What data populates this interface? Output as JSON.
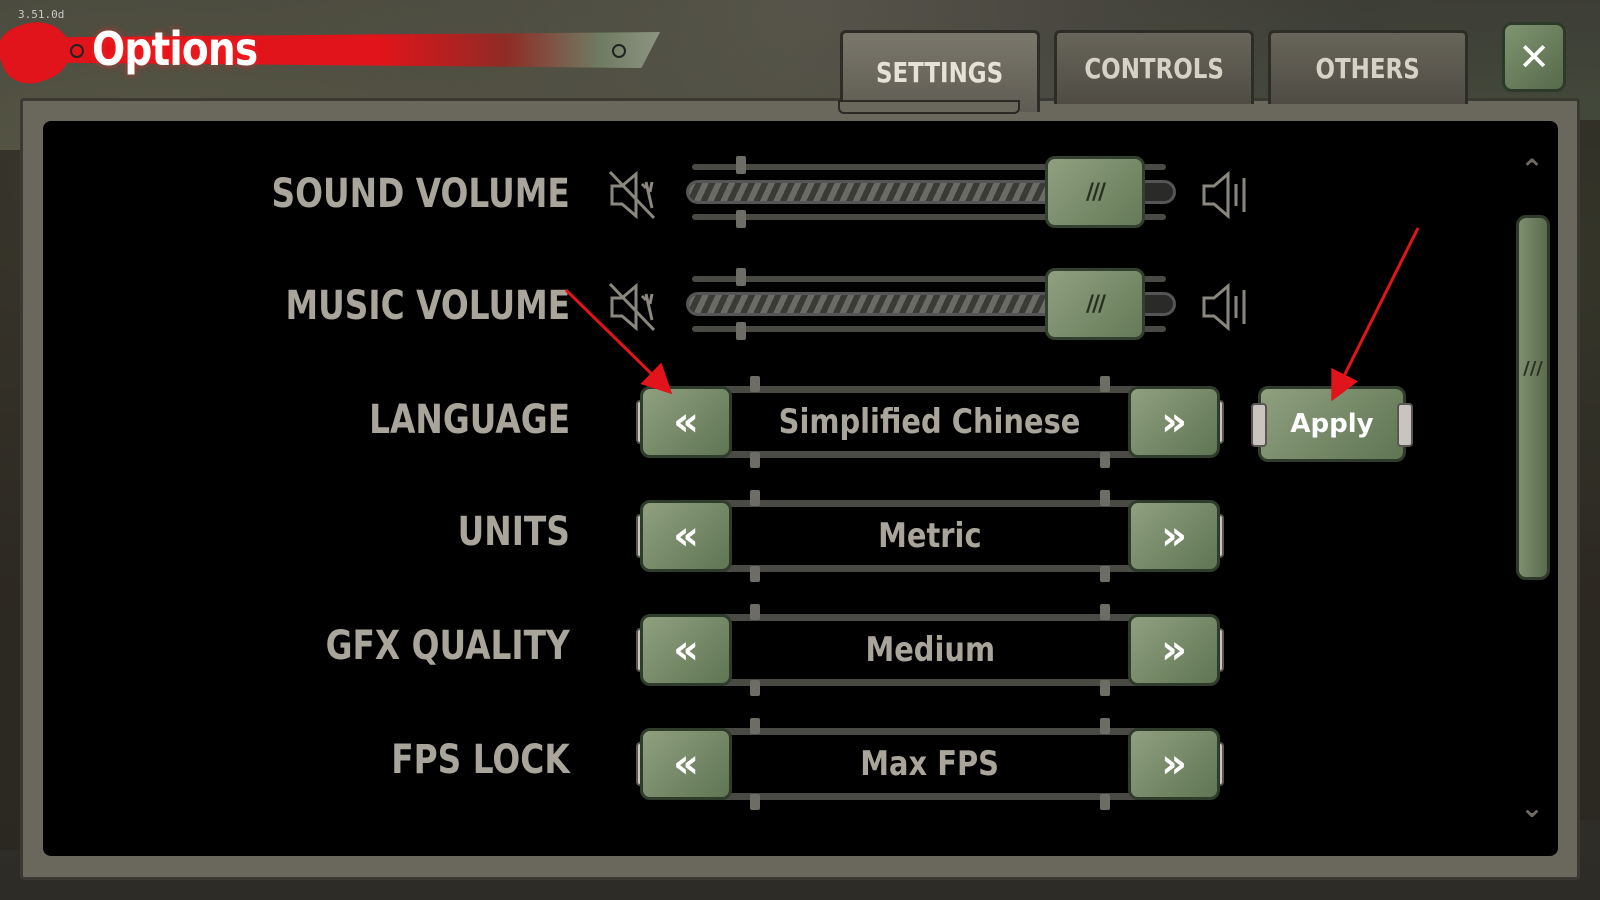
{
  "header": {
    "version": "3.51.0d",
    "title": "Options",
    "close_label": "✕"
  },
  "tabs": [
    {
      "label": "SETTINGS",
      "active": true
    },
    {
      "label": "CONTROLS",
      "active": false
    },
    {
      "label": "OTHERS",
      "active": false
    }
  ],
  "settings": {
    "sound_volume": {
      "label": "SOUND VOLUME",
      "value_fraction": 0.92
    },
    "music_volume": {
      "label": "MUSIC VOLUME",
      "value_fraction": 0.92
    },
    "language": {
      "label": "LANGUAGE",
      "value": "Simplified Chinese",
      "apply_label": "Apply"
    },
    "units": {
      "label": "UNITS",
      "value": "Metric"
    },
    "gfx_quality": {
      "label": "GFX QUALITY",
      "value": "Medium"
    },
    "fps_lock": {
      "label": "FPS LOCK",
      "value": "Max FPS"
    }
  },
  "icons": {
    "prev": "«",
    "next": "»",
    "thumb_glyph": "///",
    "scroll_up": "⌃",
    "scroll_down": "⌄",
    "mute_icon": "speaker-muted-icon",
    "loud_icon": "speaker-loud-icon"
  },
  "colors": {
    "accent_red": "#e0141a",
    "button_green": "#7d8f6e",
    "label_gray": "#a9a59a",
    "annotation_red": "#e0141a"
  }
}
